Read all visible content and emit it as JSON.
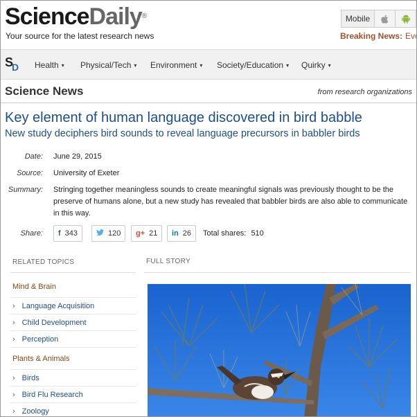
{
  "header": {
    "logo_part1": "Science",
    "logo_part2": "Daily",
    "logo_mark": "®",
    "tagline": "Your source for the latest research news",
    "platforms": {
      "mobile_label": "Mobile",
      "apple_glyph": "",
      "android_glyph": "☗"
    },
    "breaking_label": "Breaking News:",
    "breaking_value": "Evol"
  },
  "nav": {
    "mini_logo_s": "S",
    "mini_logo_d": "D",
    "items": [
      {
        "label": "Health"
      },
      {
        "label": "Physical/Tech"
      },
      {
        "label": "Environment"
      },
      {
        "label": "Society/Education"
      },
      {
        "label": "Quirky"
      }
    ],
    "caret": "▾"
  },
  "section": {
    "title": "Science News",
    "from": "from research organizations"
  },
  "article": {
    "headline": "Key element of human language discovered in bird babble",
    "subhead": "New study deciphers bird sounds to reveal language precursors in babbler birds",
    "meta": {
      "date_label": "Date:",
      "date_value": "June 29, 2015",
      "source_label": "Source:",
      "source_value": "University of Exeter",
      "summary_label": "Summary:",
      "summary_value": "Stringing together meaningless sounds to create meaningful signals was previously thought to be the preserve of humans alone, but a new study has revealed that babbler birds are also able to communicate in this way."
    },
    "share": {
      "label": "Share:",
      "facebook": {
        "icon": "f",
        "count": "343"
      },
      "twitter": {
        "icon": "🐦",
        "count": "120"
      },
      "googleplus": {
        "icon": "g+",
        "count": "21"
      },
      "linkedin": {
        "icon": "in",
        "count": "26"
      },
      "total_label": "Total shares:",
      "total_value": "510"
    }
  },
  "related": {
    "header": "RELATED TOPICS",
    "chevron": "›",
    "groups": [
      {
        "category": "Mind & Brain",
        "topics": [
          "Language Acquisition",
          "Child Development",
          "Perception"
        ]
      },
      {
        "category": "Plants & Animals",
        "topics": [
          "Birds",
          "Bird Flu Research",
          "Zoology"
        ]
      }
    ]
  },
  "full_story": {
    "header": "FULL STORY"
  },
  "colors": {
    "link_blue": "#1c4e8f",
    "category_brown": "#8b4513",
    "breaking_brown": "#a0522d",
    "sky_blue": "#1f6fd6"
  }
}
